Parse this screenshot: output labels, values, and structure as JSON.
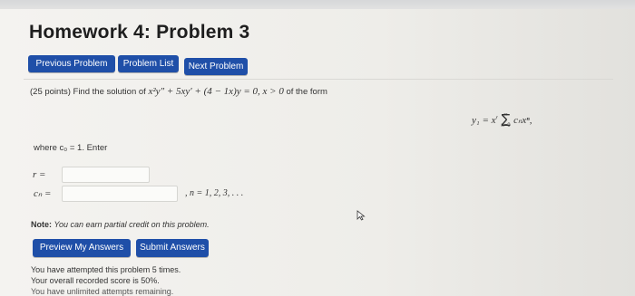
{
  "page": {
    "title": "Homework 4: Problem 3"
  },
  "nav": {
    "previous": "Previous Problem",
    "list": "Problem List",
    "next": "Next Problem"
  },
  "problem": {
    "intro": "(25 points) Find the solution of",
    "equation": "x²y″ + 5xy′ + (4 − 1x)y = 0, x > 0",
    "form_suffix": "of the form",
    "formula_lhs": "y₁ = x",
    "formula_r": "r",
    "formula_sum_top": "∞",
    "formula_sum_bottom": "n=0",
    "formula_term": "cₙxⁿ,",
    "where": "where c₀ = 1. Enter",
    "r_label": "r =",
    "cn_label": "cₙ =",
    "n_range": ", n = 1, 2, 3, . . ."
  },
  "inputs": {
    "r_value": "",
    "cn_value": ""
  },
  "note": {
    "label": "Note:",
    "text": "You can earn partial credit on this problem."
  },
  "actions": {
    "preview": "Preview My Answers",
    "submit": "Submit Answers"
  },
  "status": {
    "attempts": "You have attempted this problem 5 times.",
    "score": "Your overall recorded score is 50%.",
    "remaining": "You have unlimited attempts remaining."
  },
  "colors": {
    "button": "#1f4fa8",
    "background": "#f4f3f0"
  }
}
